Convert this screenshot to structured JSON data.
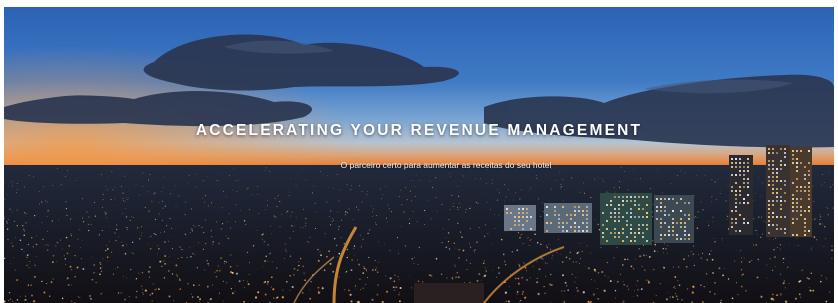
{
  "hero": {
    "headline": "ACCELERATING YOUR REVENUE MANAGEMENT",
    "subline": "O parceiro certo para aumentar as receitas do seu hotel"
  },
  "colors": {
    "sky_top": "#2f65b6",
    "sunset": "#e0793d",
    "city_dark": "#161b28",
    "city_lights": "#f0a54a"
  }
}
